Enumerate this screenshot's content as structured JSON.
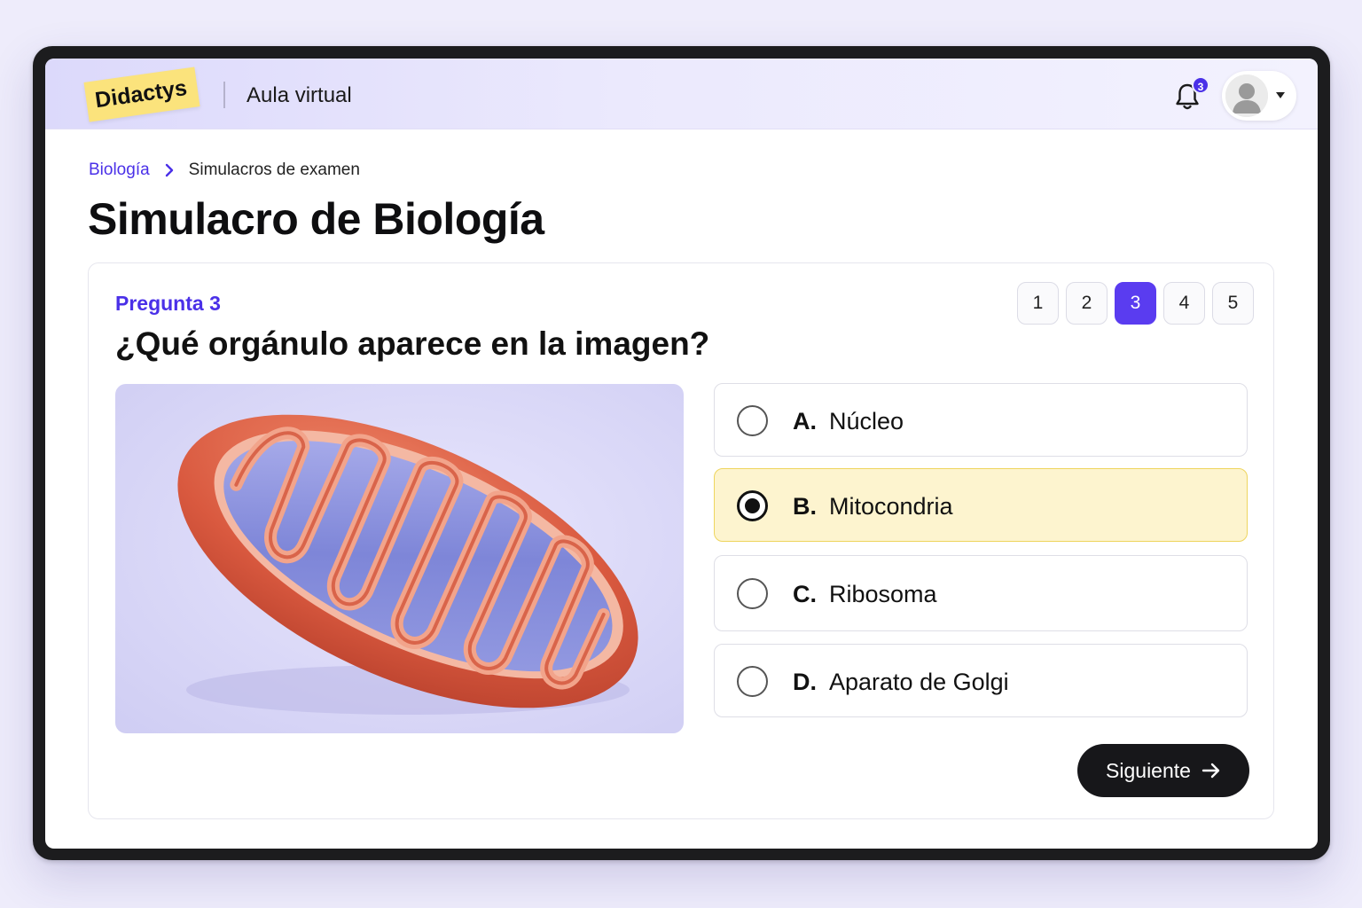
{
  "header": {
    "logo_text": "Didactys",
    "app_title": "Aula virtual",
    "notification_count": "3"
  },
  "breadcrumb": {
    "parent": "Biología",
    "current": "Simulacros de examen"
  },
  "page": {
    "title": "Simulacro de Biología"
  },
  "quiz": {
    "question_label": "Pregunta 3",
    "question_text": "¿Qué orgánulo aparece en la imagen?",
    "pages": [
      "1",
      "2",
      "3",
      "4",
      "5"
    ],
    "current_page": "3",
    "options": [
      {
        "letter": "A.",
        "text": "Núcleo",
        "selected": false
      },
      {
        "letter": "B.",
        "text": "Mitocondria",
        "selected": true
      },
      {
        "letter": "C.",
        "text": "Ribosoma",
        "selected": false
      },
      {
        "letter": "D.",
        "text": "Aparato de Golgi",
        "selected": false
      }
    ],
    "next_label": "Siguiente"
  },
  "colors": {
    "accent": "#4a30e8",
    "selected_bg": "#fdf4cf",
    "logo_bg": "#fbe37c"
  }
}
